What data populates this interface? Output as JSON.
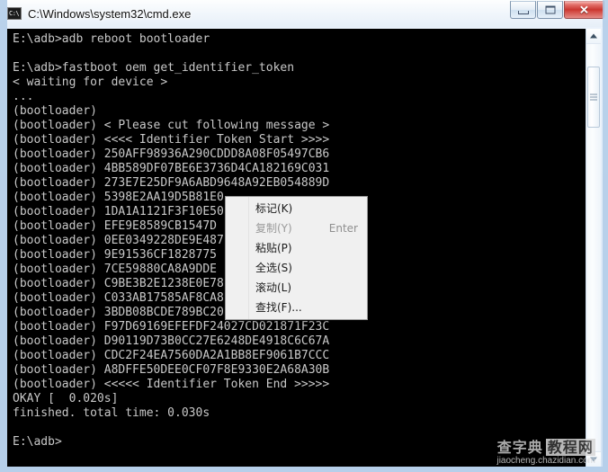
{
  "window": {
    "title": "C:\\Windows\\system32\\cmd.exe",
    "icon": "cmd-console-icon",
    "icon_glyph": "C:\\",
    "buttons": {
      "minimize": "minimize-button",
      "maximize": "maximize-button",
      "close": "close-button",
      "close_glyph": "✕"
    }
  },
  "console": {
    "background": "#000000",
    "foreground": "#c8c8c8",
    "lines": [
      "E:\\adb>adb reboot bootloader",
      "",
      "E:\\adb>fastboot oem get_identifier_token",
      "< waiting for device >",
      "...",
      "(bootloader)",
      "(bootloader) < Please cut following message >",
      "(bootloader) <<<< Identifier Token Start >>>>",
      "(bootloader) 250AFF98936A290CDDD8A08F05497CB6",
      "(bootloader) 4BB589DF07BE6E3736D4CA182169C031",
      "(bootloader) 273E7E25DF9A6ABD9648A92EB054889D",
      "(bootloader) 5398E2AA19D5B81E0",
      "(bootloader) 1DA1A1121F3F10E50",
      "(bootloader) EFE9E8589CB1547D",
      "(bootloader) 0EE0349228DE9E487",
      "(bootloader) 9E91536CF1828775",
      "(bootloader) 7CE59880CA8A9DDE",
      "(bootloader) C9BE3B2E1238E0E78",
      "(bootloader) C033AB17585AF8CA8",
      "(bootloader) 3BDB08BCDE789BC20",
      "(bootloader) F97D69169EFEFDF24027CD021871F23C",
      "(bootloader) D90119D73B0CC27E6248DE4918C6C67A",
      "(bootloader) CDC2F24EA7560DA2A1BB8EF9061B7CCC",
      "(bootloader) A8DFFE50DEE0CF07F8E9330E2A68A30B",
      "(bootloader) <<<<< Identifier Token End >>>>>",
      "OKAY [  0.020s]",
      "finished. total time: 0.030s",
      "",
      "E:\\adb>"
    ]
  },
  "scrollbar": {
    "up_arrow": "scroll-up-arrow",
    "down_arrow": "scroll-down-arrow",
    "thumb": "scroll-thumb"
  },
  "context_menu": {
    "items": [
      {
        "label": "标记(K)",
        "shortcut": "",
        "disabled": false,
        "name": "menu-item-mark"
      },
      {
        "label": "复制(Y)",
        "shortcut": "Enter",
        "disabled": true,
        "name": "menu-item-copy"
      },
      {
        "label": "粘贴(P)",
        "shortcut": "",
        "disabled": false,
        "name": "menu-item-paste"
      },
      {
        "label": "全选(S)",
        "shortcut": "",
        "disabled": false,
        "name": "menu-item-select-all"
      },
      {
        "label": "滚动(L)",
        "shortcut": "",
        "disabled": false,
        "name": "menu-item-scroll"
      },
      {
        "label": "查找(F)...",
        "shortcut": "",
        "disabled": false,
        "name": "menu-item-find"
      }
    ]
  },
  "watermark": {
    "brand": "查字典",
    "brand_boxed": "教程网",
    "url": "jiaocheng.chazidian.com"
  }
}
